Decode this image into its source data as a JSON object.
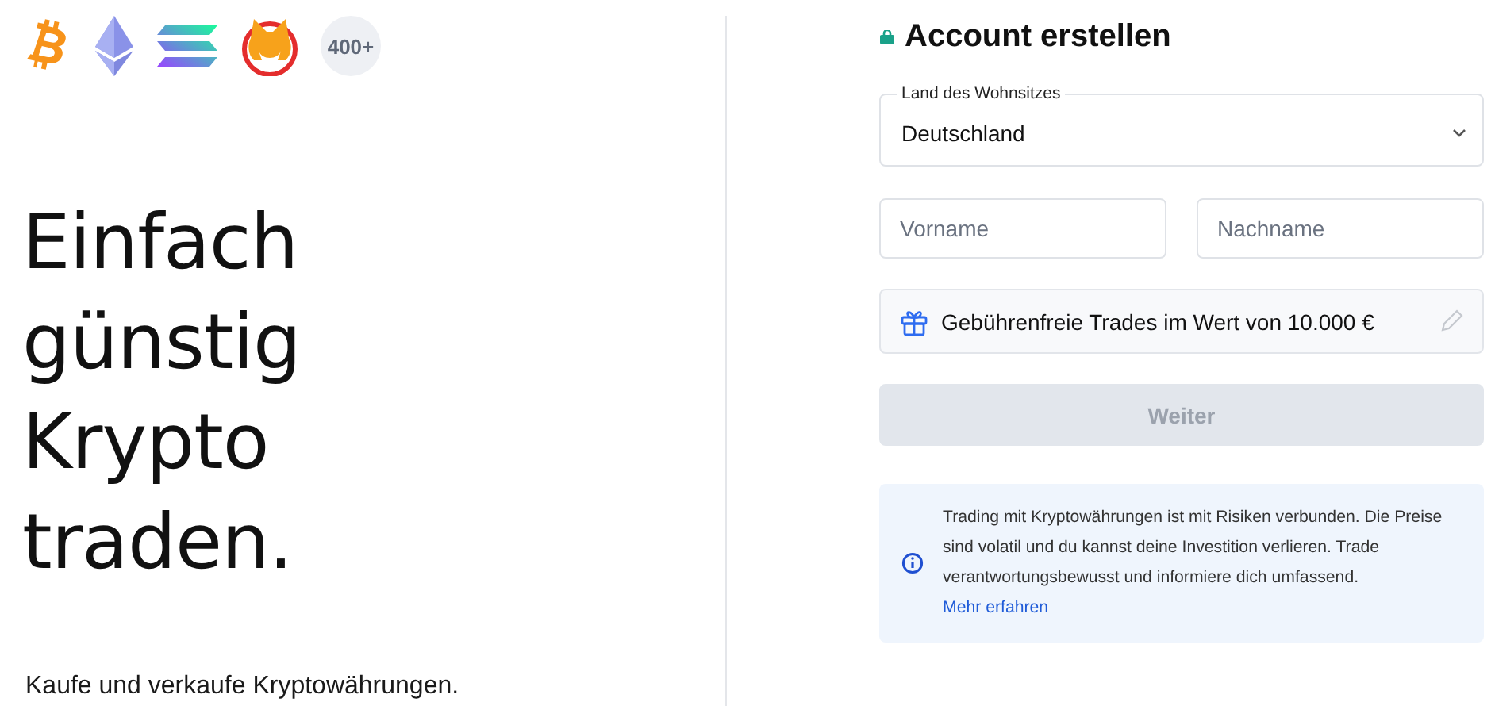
{
  "coins": {
    "more_badge": "400+"
  },
  "headline": [
    "Einfach",
    "günstig",
    "Krypto",
    "traden."
  ],
  "subtitle": "Kaufe und verkaufe Kryptowährungen.",
  "form": {
    "title": "Account erstellen",
    "country": {
      "label": "Land des Wohnsitzes",
      "value": "Deutschland"
    },
    "first_name": {
      "placeholder": "Vorname"
    },
    "last_name": {
      "placeholder": "Nachname"
    },
    "promo": {
      "text": "Gebührenfreie Trades im Wert von 10.000 €"
    },
    "submit": {
      "label": "Weiter",
      "disabled": true
    },
    "notice": {
      "text": "Trading mit Kryptowährungen ist mit Risiken verbunden. Die Preise sind volatil und du kannst deine Investition verlieren. Trade verantwortungsbewusst und informiere dich umfassend.",
      "link": "Mehr erfahren"
    }
  }
}
